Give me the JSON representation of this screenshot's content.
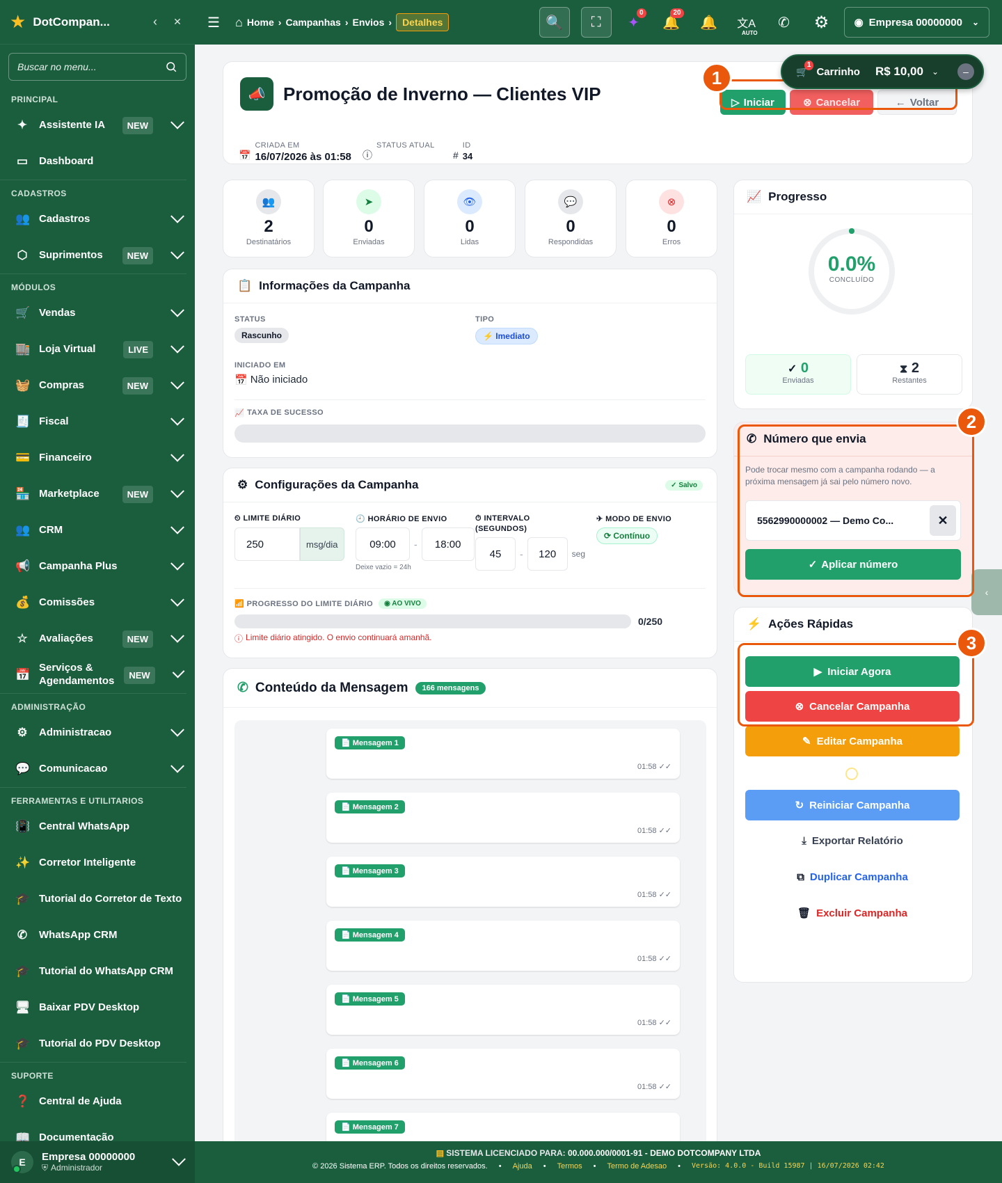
{
  "app": {
    "brand": "DotCompan..."
  },
  "sidebar": {
    "search_placeholder": "Buscar no menu...",
    "sections": {
      "principal": "PRINCIPAL",
      "cadastros": "CADASTROS",
      "modulos": "MÓDULOS",
      "administracao": "ADMINISTRAÇÃO",
      "ferramentas": "FERRAMENTAS E UTILITARIOS",
      "suporte": "SUPORTE"
    },
    "items": {
      "assistente": {
        "label": "Assistente IA",
        "badge": "NEW"
      },
      "dashboard": {
        "label": "Dashboard"
      },
      "cadastros": {
        "label": "Cadastros"
      },
      "suprimentos": {
        "label": "Suprimentos",
        "badge": "NEW"
      },
      "vendas": {
        "label": "Vendas"
      },
      "loja": {
        "label": "Loja Virtual",
        "badge": "LIVE"
      },
      "compras": {
        "label": "Compras",
        "badge": "NEW"
      },
      "fiscal": {
        "label": "Fiscal"
      },
      "financeiro": {
        "label": "Financeiro"
      },
      "marketplace": {
        "label": "Marketplace",
        "badge": "NEW"
      },
      "crm": {
        "label": "CRM"
      },
      "campanha": {
        "label": "Campanha Plus"
      },
      "comissoes": {
        "label": "Comissões"
      },
      "avaliacoes": {
        "label": "Avaliações",
        "badge": "NEW"
      },
      "servicos": {
        "label": "Serviços & Agendamentos",
        "badge": "NEW"
      },
      "administracao": {
        "label": "Administracao"
      },
      "comunicacao": {
        "label": "Comunicacao"
      },
      "central_whatsapp": {
        "label": "Central WhatsApp"
      },
      "corretor": {
        "label": "Corretor Inteligente"
      },
      "tutorial_corretor": {
        "label": "Tutorial do Corretor de Texto"
      },
      "whatsapp_crm": {
        "label": "WhatsApp CRM"
      },
      "tutorial_crm": {
        "label": "Tutorial do WhatsApp CRM"
      },
      "baixar_pdv": {
        "label": "Baixar PDV Desktop"
      },
      "tutorial_pdv": {
        "label": "Tutorial do PDV Desktop"
      },
      "central_ajuda": {
        "label": "Central de Ajuda"
      },
      "documentacao": {
        "label": "Documentação"
      }
    },
    "footer": {
      "avatar": "E",
      "company": "Empresa 00000000",
      "role": "Administrador"
    }
  },
  "topbar": {
    "breadcrumb": {
      "home": "Home",
      "b1": "Campanhas",
      "b2": "Envios",
      "current": "Detalhes"
    },
    "ai_badge": "0",
    "notif_badge": "20",
    "auto_label": "AUTO",
    "company": "Empresa 00000000"
  },
  "cart": {
    "label": "Carrinho",
    "count": "1",
    "total": "R$ 10,00"
  },
  "campaign": {
    "title": "Promoção de Inverno — Clientes VIP",
    "created_label": "CRIADA EM",
    "created_value": "16/07/2026 às 01:58",
    "status_label": "STATUS ATUAL",
    "id_label": "ID",
    "id_value": "34",
    "btn_start": "Iniciar",
    "btn_cancel": "Cancelar",
    "btn_back": "Voltar"
  },
  "stats": [
    {
      "value": "2",
      "label": "Destinatários"
    },
    {
      "value": "0",
      "label": "Enviadas"
    },
    {
      "value": "0",
      "label": "Lidas"
    },
    {
      "value": "0",
      "label": "Respondidas"
    },
    {
      "value": "0",
      "label": "Erros"
    }
  ],
  "info": {
    "title": "Informações da Campanha",
    "status_label": "STATUS",
    "status_value": "Rascunho",
    "type_label": "TIPO",
    "type_value": "Imediato",
    "started_label": "INICIADO EM",
    "started_value": "Não iniciado",
    "success_label": "TAXA DE SUCESSO",
    "success_rate": 0
  },
  "config": {
    "title": "Configurações da Campanha",
    "saved": "Salvo",
    "limit_label": "LIMITE DIÁRIO",
    "limit_value": "250",
    "limit_unit": "msg/dia",
    "hours_label": "HORÁRIO DE ENVIO",
    "hour_start": "09:00",
    "hour_end": "18:00",
    "hours_hint": "Deixe vazio = 24h",
    "interval_label": "INTERVALO",
    "interval_sub": "(SEGUNDOS)",
    "interval_min": "45",
    "interval_max": "120",
    "interval_unit": "seg",
    "mode_label": "MODO DE ENVIO",
    "mode_value": "Contínuo",
    "progress_label": "PROGRESSO DO LIMITE DIÁRIO",
    "live": "AO VIVO",
    "progress_count": "0/250",
    "progress_fraction": 0,
    "warning": "Limite diário atingido. O envio continuará amanhã."
  },
  "messages": {
    "title": "Conteúdo da Mensagem",
    "count_badge": "166 mensagens",
    "items": [
      {
        "label": "Mensagem 1",
        "time": "01:58"
      },
      {
        "label": "Mensagem 2",
        "time": "01:58"
      },
      {
        "label": "Mensagem 3",
        "time": "01:58"
      },
      {
        "label": "Mensagem 4",
        "time": "01:58"
      },
      {
        "label": "Mensagem 5",
        "time": "01:58"
      },
      {
        "label": "Mensagem 6",
        "time": "01:58"
      },
      {
        "label": "Mensagem 7",
        "time": ""
      }
    ]
  },
  "progress": {
    "title": "Progresso",
    "percent": "0.0%",
    "caption": "CONCLUÍDO",
    "fraction": 0,
    "sent_value": "0",
    "sent_label": "Enviadas",
    "remaining_value": "2",
    "remaining_label": "Restantes"
  },
  "sender": {
    "title": "Número que envia",
    "hint": "Pode trocar mesmo com a campanha rodando — a próxima mensagem já sai pelo número novo.",
    "value": "5562990000002 — Demo Co...",
    "apply": "Aplicar número"
  },
  "quick": {
    "title": "Ações Rápidas",
    "start": "Iniciar Agora",
    "cancel": "Cancelar Campanha",
    "edit": "Editar Campanha",
    "restart": "Reiniciar Campanha",
    "export": "Exportar Relatório",
    "duplicate": "Duplicar Campanha",
    "delete": "Excluir Campanha"
  },
  "annotations": [
    "1",
    "2",
    "3"
  ],
  "footer": {
    "license_label": "SISTEMA LICENCIADO PARA:",
    "license_value": "00.000.000/0001-91 - DEMO DOTCOMPANY LTDA",
    "copyright": "© 2026 Sistema ERP. Todos os direitos reservados.",
    "help": "Ajuda",
    "terms": "Termos",
    "adhesion": "Termo de Adesao",
    "version": "Versão: 4.0.0 - Build 15987 | 16/07/2026 02:42"
  },
  "colors": {
    "primary": "#1b5e3e",
    "success": "#22a06b",
    "danger": "#ef4444",
    "warning": "#f59e0b",
    "info": "#3b82f6",
    "annotation": "#ea580c"
  }
}
